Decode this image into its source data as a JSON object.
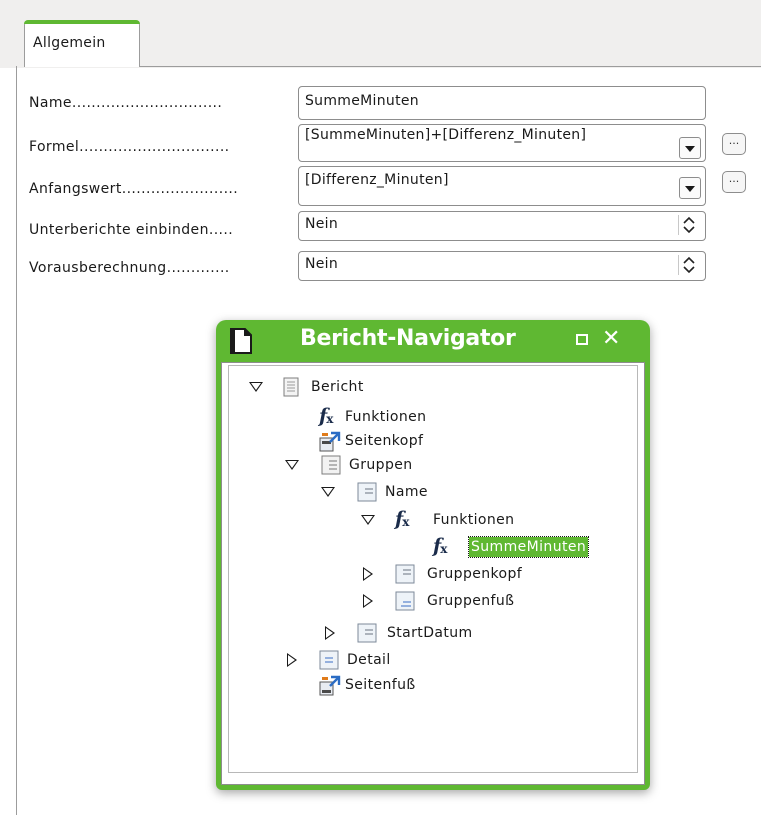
{
  "tabs": [
    {
      "label": "Allgemein",
      "active": true
    }
  ],
  "properties": {
    "name": {
      "label": "Name...............................",
      "value": "SummeMinuten"
    },
    "formula": {
      "label": "Formel...............................",
      "value": "[SummeMinuten]+[Differenz_Minuten]",
      "more_label": "..."
    },
    "initial_value": {
      "label": "Anfangswert........................",
      "value": "[Differenz_Minuten]",
      "more_label": "..."
    },
    "include_subreports": {
      "label": "Unterberichte einbinden.....",
      "value": "Nein"
    },
    "precalculation": {
      "label": "Vorausberechnung.............",
      "value": "Nein"
    }
  },
  "navigator": {
    "title": "Bericht-Navigator",
    "accent_color": "#5fb832",
    "tree": {
      "report": "Bericht",
      "functions": "Funktionen",
      "page_header": "Seitenkopf",
      "groups": "Gruppen",
      "group_name": "Name",
      "group_functions": "Funktionen",
      "selected_function": "SummeMinuten",
      "group_header": "Gruppenkopf",
      "group_footer": "Gruppenfuß",
      "group_startdate": "StartDatum",
      "detail": "Detail",
      "page_footer": "Seitenfuß"
    },
    "icons": {
      "report": "report-icon",
      "function": "fx-icon",
      "page_section": "page-section-icon",
      "group": "group-icon",
      "section": "section-icon"
    }
  }
}
